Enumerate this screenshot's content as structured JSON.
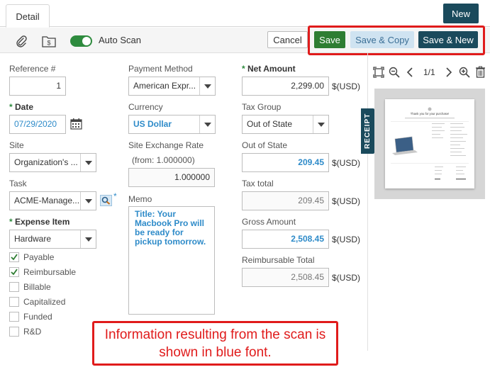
{
  "tabs": {
    "detail": "Detail"
  },
  "header": {
    "new_label": "New"
  },
  "toolbar": {
    "auto_scan_label": "Auto Scan",
    "auto_scan_on": true,
    "cancel_label": "Cancel",
    "save_label": "Save",
    "save_copy_label": "Save & Copy",
    "save_new_label": "Save & New"
  },
  "form": {
    "reference": {
      "label": "Reference #",
      "value": "1"
    },
    "date": {
      "label": "Date",
      "value": "07/29/2020"
    },
    "site": {
      "label": "Site",
      "value": "Organization's ..."
    },
    "task": {
      "label": "Task",
      "value": "ACME-Manage..."
    },
    "expense_item": {
      "label": "Expense Item",
      "value": "Hardware"
    },
    "payment_method": {
      "label": "Payment Method",
      "value": "American Expr..."
    },
    "currency": {
      "label": "Currency",
      "value": "US Dollar"
    },
    "site_exchange_rate": {
      "label": "Site Exchange Rate",
      "note": "(from: 1.000000)",
      "value": "1.000000"
    },
    "memo": {
      "label": "Memo",
      "value": "Title: Your Macbook Pro will be ready for pickup tomorrow."
    },
    "net_amount": {
      "label": "Net Amount",
      "value": "2,299.00",
      "unit": "$(USD)"
    },
    "tax_group": {
      "label": "Tax Group",
      "value": "Out of State"
    },
    "out_of_state": {
      "label": "Out of State",
      "value": "209.45",
      "unit": "$(USD)"
    },
    "tax_total": {
      "label": "Tax total",
      "value": "209.45",
      "unit": "$(USD)"
    },
    "gross_amount": {
      "label": "Gross Amount",
      "value": "2,508.45",
      "unit": "$(USD)"
    },
    "reimbursable_total": {
      "label": "Reimbursable Total",
      "value": "2,508.45",
      "unit": "$(USD)"
    }
  },
  "checkboxes": [
    {
      "label": "Payable",
      "checked": true
    },
    {
      "label": "Reimbursable",
      "checked": true
    },
    {
      "label": "Billable",
      "checked": false
    },
    {
      "label": "Capitalized",
      "checked": false
    },
    {
      "label": "Funded",
      "checked": false
    },
    {
      "label": "R&D",
      "checked": false
    }
  ],
  "receipt": {
    "tab_label": "RECEIPT",
    "page_indicator": "1/1",
    "doc_heading": "Thank you for your purchase!"
  },
  "callout": {
    "text": "Information resulting from the scan is shown in blue font."
  },
  "colors": {
    "scan_blue": "#2e8bc9",
    "primary_dark": "#1a4a5c",
    "save_green": "#2e7d32",
    "highlight_red": "#e01b1b"
  }
}
